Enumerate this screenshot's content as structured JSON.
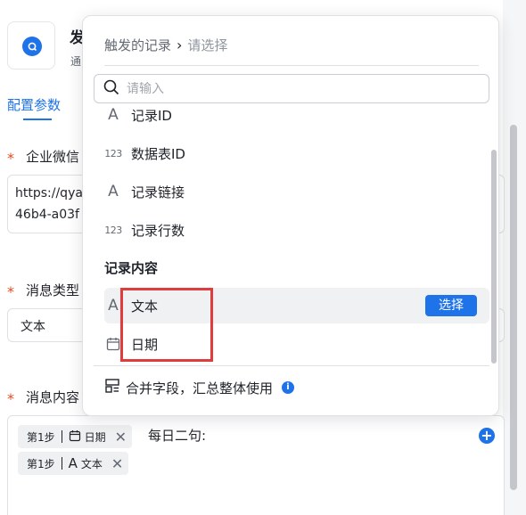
{
  "background": {
    "app_title": "发",
    "app_subtitle": "通",
    "tab_config": "配置参数",
    "fields": [
      {
        "label": "企业微信",
        "required": "*"
      },
      {
        "label": "消息类型",
        "required": "*"
      },
      {
        "label": "消息内容",
        "required": "*"
      }
    ],
    "webhook_value_line1": "https://qya",
    "webhook_value_line2": "46b4-a03f",
    "msgtype_value": "文本",
    "content_chips": [
      {
        "step": "第1步",
        "field": "日期",
        "icon": "calendar-icon"
      },
      {
        "step": "第1步",
        "field": "文本",
        "icon": "text-a-icon"
      }
    ],
    "content_text": "每日二句:",
    "plus": "+"
  },
  "dropdown": {
    "breadcrumb_root": "触发的记录",
    "breadcrumb_sep": "›",
    "breadcrumb_current": "请选择",
    "search_placeholder": "请输入",
    "items": [
      {
        "label": "记录ID",
        "icon": "text-a-icon",
        "glyph": "A"
      },
      {
        "label": "数据表ID",
        "icon": "number-123-icon",
        "glyph": "123"
      },
      {
        "label": "记录链接",
        "icon": "text-a-icon",
        "glyph": "A"
      },
      {
        "label": "记录行数",
        "icon": "number-123-icon",
        "glyph": "123"
      }
    ],
    "section_title": "记录内容",
    "content_items": [
      {
        "label": "文本",
        "icon": "text-a-icon",
        "glyph": "A"
      },
      {
        "label": "日期",
        "icon": "calendar-icon"
      }
    ],
    "select_button": "选择",
    "footer_text": "合并字段，汇总整体使用",
    "footer_info": "i"
  },
  "colors": {
    "accent": "#1f73e8",
    "highlight_box": "#e03c3c",
    "required": "#e34a1b"
  }
}
